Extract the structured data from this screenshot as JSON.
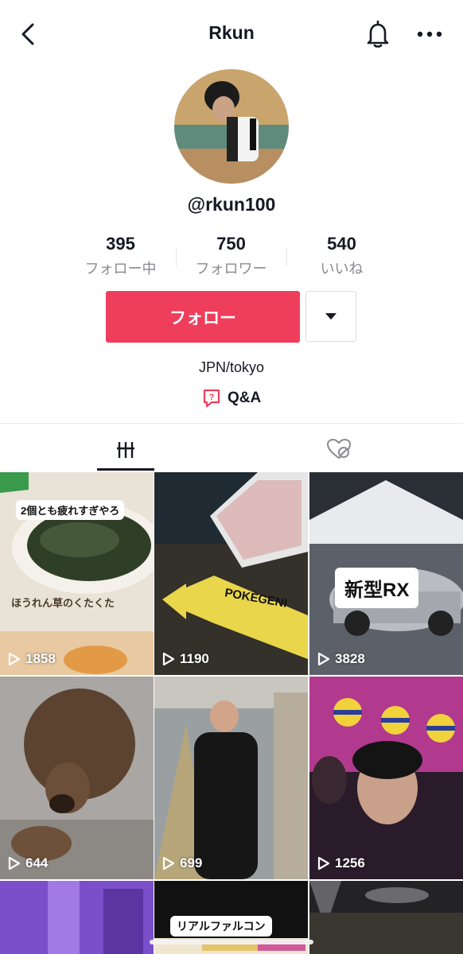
{
  "header": {
    "title": "Rkun"
  },
  "profile": {
    "handle": "@rkun100",
    "bio": "JPN/tokyo",
    "qa_label": "Q&A"
  },
  "stats": [
    {
      "value": "395",
      "label": "フォロー中"
    },
    {
      "value": "750",
      "label": "フォロワー"
    },
    {
      "value": "540",
      "label": "いいね"
    }
  ],
  "actions": {
    "follow_label": "フォロー"
  },
  "tabs": {
    "videos": "videos-grid-icon",
    "liked": "liked-hidden-icon"
  },
  "videos": [
    {
      "views": "1858",
      "overlay": "2個とも疲れすぎやろ",
      "caption": "ほうれん草のくたくた"
    },
    {
      "views": "1190",
      "overlay": "POKÉGENI"
    },
    {
      "views": "3828",
      "overlay": "新型RX"
    },
    {
      "views": "644"
    },
    {
      "views": "699"
    },
    {
      "views": "1256"
    },
    {
      "views": ""
    },
    {
      "views": "",
      "overlay": "リアルファルコン"
    },
    {
      "views": ""
    }
  ],
  "colors": {
    "accent": "#ee3e5c",
    "text": "#161823",
    "muted": "#8a8b91"
  }
}
